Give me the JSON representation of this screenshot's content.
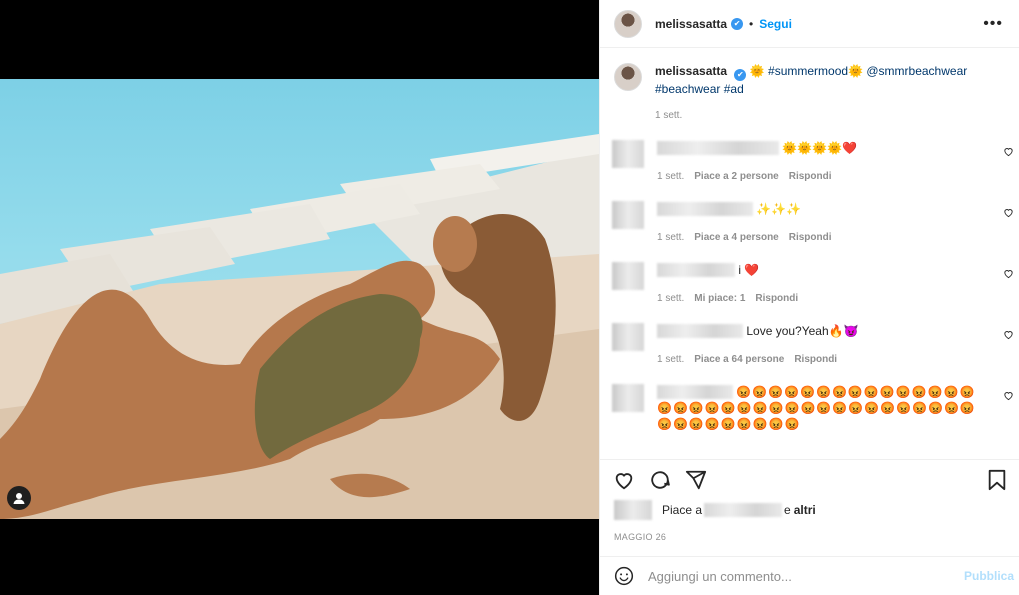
{
  "post": {
    "username": "melissasatta",
    "verified_mark": "✔",
    "separator": "•",
    "follow_label": "Segui",
    "more_label": "•••"
  },
  "caption": {
    "username": "melissasatta",
    "emoji": "🌞",
    "hashtag1": "#summermood",
    "emoji2": "🌞",
    "mention": "@smmrbeachwear",
    "hashtag2": "#beachwear",
    "hashtag3": "#ad",
    "time": "1 sett."
  },
  "comments": [
    {
      "text_tail": "🌞🌞🌞🌞❤️",
      "time": "1 sett.",
      "likes": "Piace a 2 persone",
      "reply": "Rispondi"
    },
    {
      "text_tail": "✨✨✨",
      "time": "1 sett.",
      "likes": "Piace a 4 persone",
      "reply": "Rispondi"
    },
    {
      "text_tail": "❤️",
      "text_prefix": "i",
      "time": "1 sett.",
      "likes": "Mi piace: 1",
      "reply": "Rispondi"
    },
    {
      "text_tail": "Love you?Yeah🔥😈",
      "time": "1 sett.",
      "likes": "Piace a 64 persone",
      "reply": "Rispondi"
    },
    {
      "text_tail": "😡😡😡😡😡😡😡😡😡😡😡😡😡😡😡😡😡😡😡😡😡😡😡😡😡😡😡😡😡😡😡😡😡😡😡😡😡😡😡😡😡😡😡😡"
    }
  ],
  "likes_bar": {
    "prefix": "Piace a",
    "suffix": "e",
    "others": "altri"
  },
  "date": "MAGGIO 26",
  "composer": {
    "placeholder": "Aggiungi un commento...",
    "publish_label": "Pubblica"
  },
  "icons": [
    "tag-user-icon",
    "verified-icon",
    "more-icon",
    "heart-icon",
    "comment-icon",
    "share-icon",
    "bookmark-icon",
    "emoji-icon"
  ]
}
